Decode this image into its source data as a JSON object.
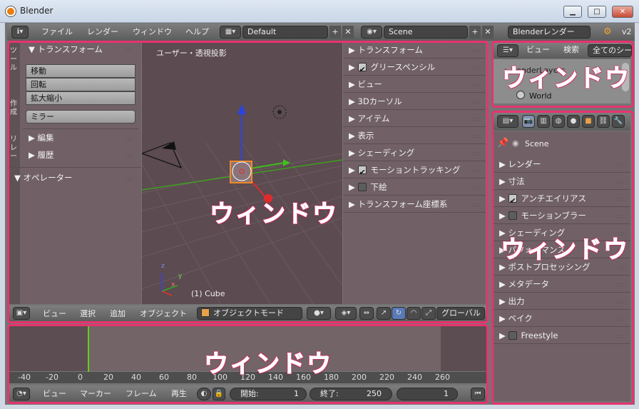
{
  "window": {
    "title": "Blender",
    "min": "▁",
    "max": "□",
    "close": "✕"
  },
  "info_header": {
    "menu": [
      "ファイル",
      "レンダー",
      "ウィンドウ",
      "ヘルプ"
    ],
    "layout": "Default",
    "scene": "Scene",
    "engine": "Blenderレンダー",
    "version": "v2"
  },
  "toolshelf": {
    "tabs": [
      "ツ",
      "ー",
      "ル",
      "作",
      "成",
      "リ",
      "レ",
      "ー"
    ],
    "transform": "トランスフォーム",
    "buttons": [
      "移動",
      "回転",
      "拡大縮小"
    ],
    "mirror": "ミラー",
    "edit": "編集",
    "history": "履歴",
    "operator": "オペレーター"
  },
  "viewport": {
    "view_label": "ユーザー・透視投影",
    "object_label": "(1) Cube",
    "axis_x": "x",
    "axis_y": "y",
    "axis_z": "z"
  },
  "properties_n": {
    "items": [
      {
        "label": "トランスフォーム",
        "checkbox": "none"
      },
      {
        "label": "グリースペンシル",
        "checkbox": "on"
      },
      {
        "label": "ビュー",
        "checkbox": "none"
      },
      {
        "label": "3Dカーソル",
        "checkbox": "none"
      },
      {
        "label": "アイテム",
        "checkbox": "none"
      },
      {
        "label": "表示",
        "checkbox": "none"
      },
      {
        "label": "シェーディング",
        "checkbox": "none"
      },
      {
        "label": "モーショントラッキング",
        "checkbox": "on"
      },
      {
        "label": "下絵",
        "checkbox": "off"
      },
      {
        "label": "トランスフォーム座標系",
        "checkbox": "none"
      }
    ]
  },
  "view3d_header": {
    "menu": [
      "ビュー",
      "選択",
      "追加",
      "オブジェクト"
    ],
    "mode": "オブジェクトモード",
    "orientation": "グローバル"
  },
  "timeline": {
    "ticks": [
      "-40",
      "-20",
      "0",
      "20",
      "40",
      "60",
      "80",
      "100",
      "120",
      "140",
      "160",
      "180",
      "200",
      "220",
      "240",
      "260"
    ],
    "menu": [
      "ビュー",
      "マーカー",
      "フレーム",
      "再生"
    ],
    "start_label": "開始:",
    "start": "1",
    "end_label": "終了:",
    "end": "250",
    "current": "1"
  },
  "outliner": {
    "menu": [
      "ビュー",
      "検索"
    ],
    "filter": "全てのシー",
    "items": [
      "RenderLayers",
      "World"
    ]
  },
  "properties": {
    "scene": "Scene",
    "items": [
      {
        "label": "レンダー",
        "checkbox": "none"
      },
      {
        "label": "寸法",
        "checkbox": "none"
      },
      {
        "label": "アンチエイリアス",
        "checkbox": "on"
      },
      {
        "label": "モーションブラー",
        "checkbox": "off"
      },
      {
        "label": "シェーディング",
        "checkbox": "none"
      },
      {
        "label": "パフォーマンス",
        "checkbox": "none"
      },
      {
        "label": "ポストプロセッシング",
        "checkbox": "none"
      },
      {
        "label": "メタデータ",
        "checkbox": "none"
      },
      {
        "label": "出力",
        "checkbox": "none"
      },
      {
        "label": "ベイク",
        "checkbox": "none"
      },
      {
        "label": "Freestyle",
        "checkbox": "off"
      }
    ]
  },
  "overlay_label": "ウィンドウ",
  "colors": {
    "overlay": "#e8336e",
    "panel": "#716167",
    "viewport": "#5c4b50"
  }
}
